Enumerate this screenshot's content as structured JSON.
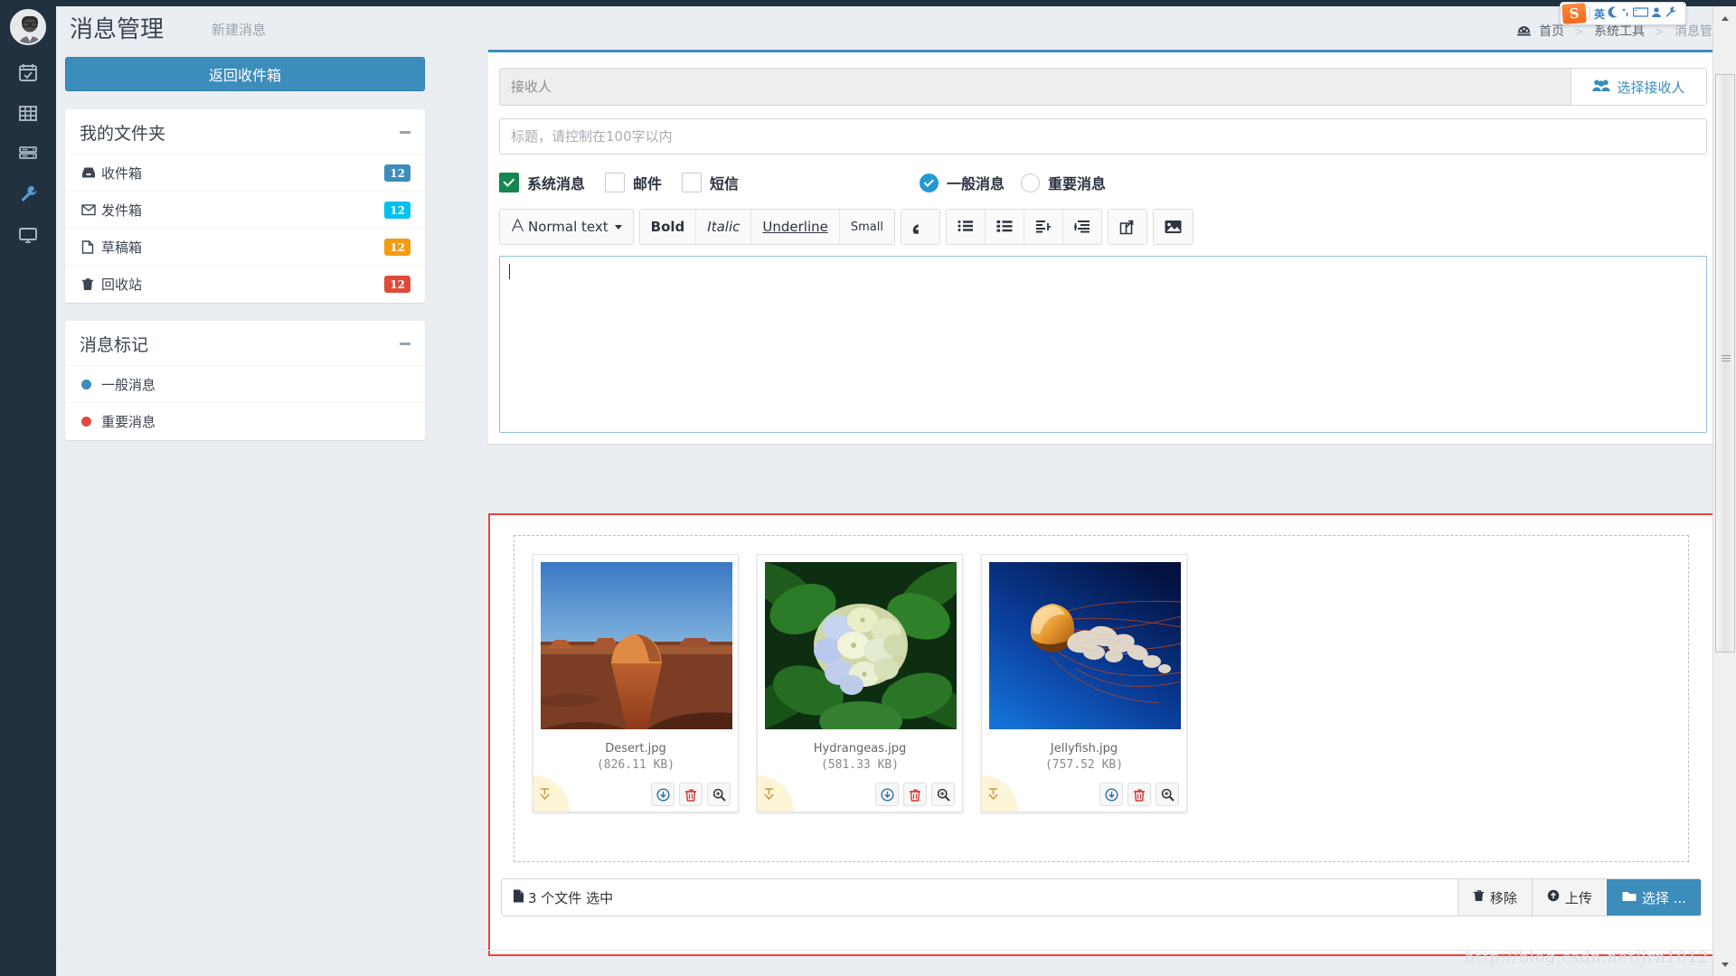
{
  "app": {
    "page_title": "消息管理",
    "page_subtitle": "新建消息",
    "watermark": "http://blog.csdn.net/jrn1012"
  },
  "breadcrumb": {
    "home_icon": "dashboard-icon",
    "items": [
      "首页",
      "系统工具",
      "消息管理"
    ],
    "separator": ">"
  },
  "ime": {
    "logo_text": "S",
    "lang_label": "英",
    "icons": [
      "moon-icon",
      "comma-icon",
      "keyboard-icon",
      "user-icon",
      "wrench-icon"
    ]
  },
  "nav_rail": {
    "avatar": "user-avatar",
    "items": [
      {
        "name": "calendar-check-icon"
      },
      {
        "name": "table-grid-icon"
      },
      {
        "name": "server-icon"
      },
      {
        "name": "wrench-icon"
      },
      {
        "name": "monitor-icon"
      }
    ]
  },
  "sidebar": {
    "back_button_label": "返回收件箱",
    "folders": {
      "title": "我的文件夹",
      "collapse_icon": "minus-icon",
      "items": [
        {
          "label": "收件箱",
          "icon": "inbox-icon",
          "count": "12",
          "color": "#3c8dbc"
        },
        {
          "label": "发件箱",
          "icon": "envelope-icon",
          "count": "12",
          "color": "#00c0ef"
        },
        {
          "label": "草稿箱",
          "icon": "file-icon",
          "count": "12",
          "color": "#f39c12"
        },
        {
          "label": "回收站",
          "icon": "trash-icon",
          "count": "12",
          "color": "#dd4b39"
        }
      ]
    },
    "labels": {
      "title": "消息标记",
      "collapse_icon": "minus-icon",
      "items": [
        {
          "label": "一般消息",
          "color": "#3c8dbc"
        },
        {
          "label": "重要消息",
          "color": "#dd4b39"
        }
      ]
    }
  },
  "compose": {
    "recipient": {
      "value": "",
      "placeholder": "接收人"
    },
    "pick_recipient": {
      "label": "选择接收人",
      "icon": "users-icon"
    },
    "subject": {
      "value": "",
      "placeholder": "标题，请控制在100字以内"
    },
    "channels": [
      {
        "label": "系统消息",
        "checked": true
      },
      {
        "label": "邮件",
        "checked": false
      },
      {
        "label": "短信",
        "checked": false
      }
    ],
    "priority": [
      {
        "label": "一般消息",
        "selected": true
      },
      {
        "label": "重要消息",
        "selected": false
      }
    ],
    "toolbar": {
      "style_select": {
        "label": "Normal text",
        "icon": "font-a-icon"
      },
      "groups": [
        [
          {
            "label": "Bold",
            "name": "bold-button"
          },
          {
            "label": "Italic",
            "name": "italic-button"
          },
          {
            "label": "Underline",
            "name": "underline-button"
          },
          {
            "label": "Small",
            "name": "small-button"
          }
        ],
        [
          {
            "label": "“",
            "name": "blockquote-button"
          }
        ],
        [
          {
            "label": "",
            "name": "unordered-list-button"
          },
          {
            "label": "",
            "name": "ordered-list-button"
          },
          {
            "label": "",
            "name": "outdent-button"
          },
          {
            "label": "",
            "name": "indent-button"
          }
        ],
        [
          {
            "label": "",
            "name": "insert-link-button"
          }
        ],
        [
          {
            "label": "",
            "name": "insert-image-button"
          }
        ]
      ]
    },
    "body": {
      "value": ""
    }
  },
  "attachments": {
    "highlight_color": "#f0433a",
    "files": [
      {
        "name": "Desert.jpg",
        "size": "(826.11 KB)",
        "thumb": "desert-photo"
      },
      {
        "name": "Hydrangeas.jpg",
        "size": "(581.33 KB)",
        "thumb": "hydrangeas-photo"
      },
      {
        "name": "Jellyfish.jpg",
        "size": "(757.52 KB)",
        "thumb": "jellyfish-photo"
      }
    ],
    "card_actions": [
      {
        "name": "download-button",
        "icon": "download-circle-icon"
      },
      {
        "name": "delete-button",
        "icon": "trash-icon"
      },
      {
        "name": "preview-button",
        "icon": "magnifier-icon"
      }
    ],
    "status_text": "3 个文件 选中",
    "status_icon": "file-icon",
    "buttons": [
      {
        "label": "移除",
        "icon": "trash-icon",
        "name": "remove-button",
        "primary": false
      },
      {
        "label": "上传",
        "icon": "upload-icon",
        "name": "upload-button",
        "primary": false
      },
      {
        "label": "选择 ...",
        "icon": "folder-icon",
        "name": "browse-button",
        "primary": true
      }
    ]
  },
  "scrollbar": {
    "up_icon": "triangle-up-icon",
    "down_icon": "triangle-down-icon"
  }
}
